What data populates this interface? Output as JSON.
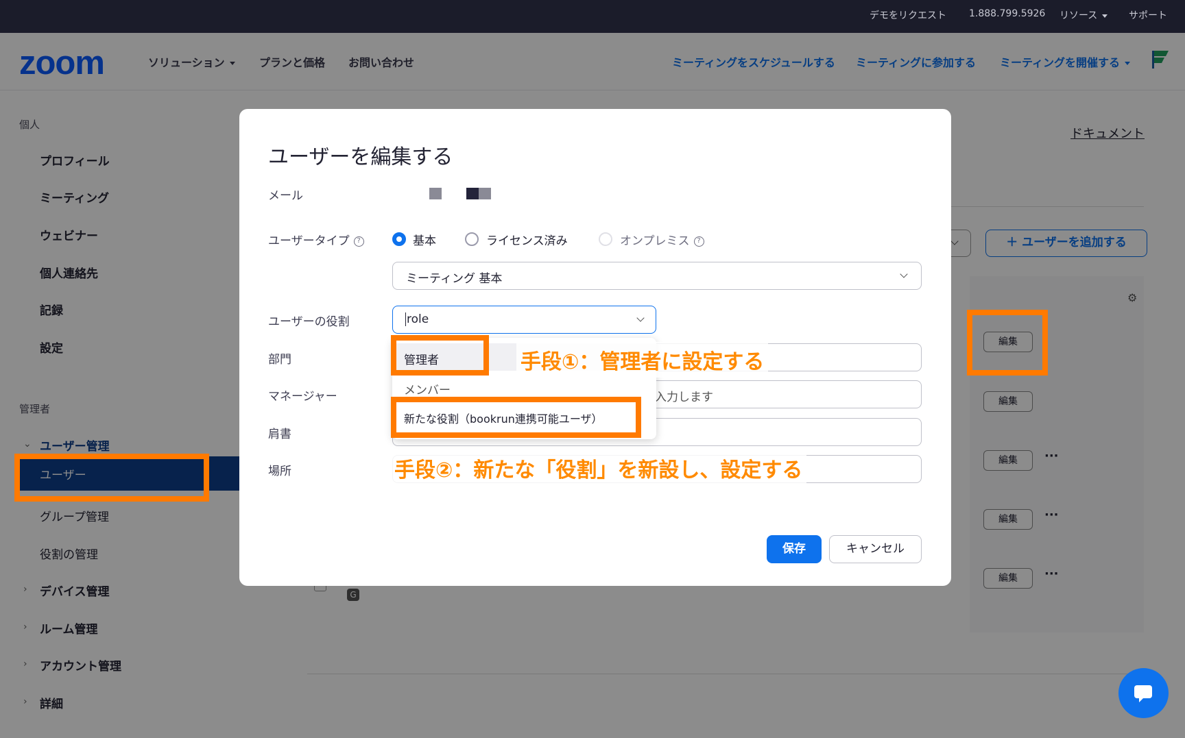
{
  "topbar": {
    "request_demo": "デモをリクエスト",
    "phone": "1.888.799.5926",
    "resources": "リソース",
    "support": "サポート"
  },
  "header": {
    "logo": "zoom",
    "solutions": "ソリューション",
    "plans": "プランと価格",
    "contact": "お問い合わせ",
    "schedule": "ミーティングをスケジュールする",
    "join": "ミーティングに参加する",
    "host": "ミーティングを開催する"
  },
  "sidebar": {
    "personal_title": "個人",
    "personal_items": [
      "プロフィール",
      "ミーティング",
      "ウェビナー",
      "個人連絡先",
      "記録",
      "設定"
    ],
    "admin_title": "管理者",
    "user_mgmt": "ユーザー管理",
    "users": "ユーザー",
    "group_mgmt": "グループ管理",
    "role_mgmt": "役割の管理",
    "device_mgmt": "デバイス管理",
    "room_mgmt": "ルーム管理",
    "account_mgmt": "アカウント管理",
    "details": "詳細"
  },
  "main": {
    "document_link": "ドキュメント",
    "add_user": "＋ ユーザーを追加する",
    "edit_label": "編集",
    "more": "···",
    "g_badge": "G"
  },
  "modal": {
    "title": "ユーザーを編集する",
    "email_label": "メール",
    "user_type_label": "ユーザータイプ",
    "type_basic": "基本",
    "type_licensed": "ライセンス済み",
    "type_onprem": "オンプレミス",
    "meeting_select": "ミーティング 基本",
    "role_label": "ユーザーの役割",
    "role_value": "role",
    "department_label": "部門",
    "manager_label": "マネージャー",
    "manager_placeholder": "入力します",
    "title_label": "肩書",
    "location_label": "場所",
    "role_options": [
      "管理者",
      "メンバー",
      "新たな役割（bookrun連携可能ユーザ）"
    ],
    "save": "保存",
    "cancel": "キャンセル"
  },
  "annotations": {
    "method1": "手段①：管理者に設定する",
    "method2": "手段②：新たな「役割」を新設し、設定する"
  },
  "colors": {
    "accent": "#0e72ed",
    "annotation": "#ff7a00",
    "topbar": "#1b1c2a"
  }
}
